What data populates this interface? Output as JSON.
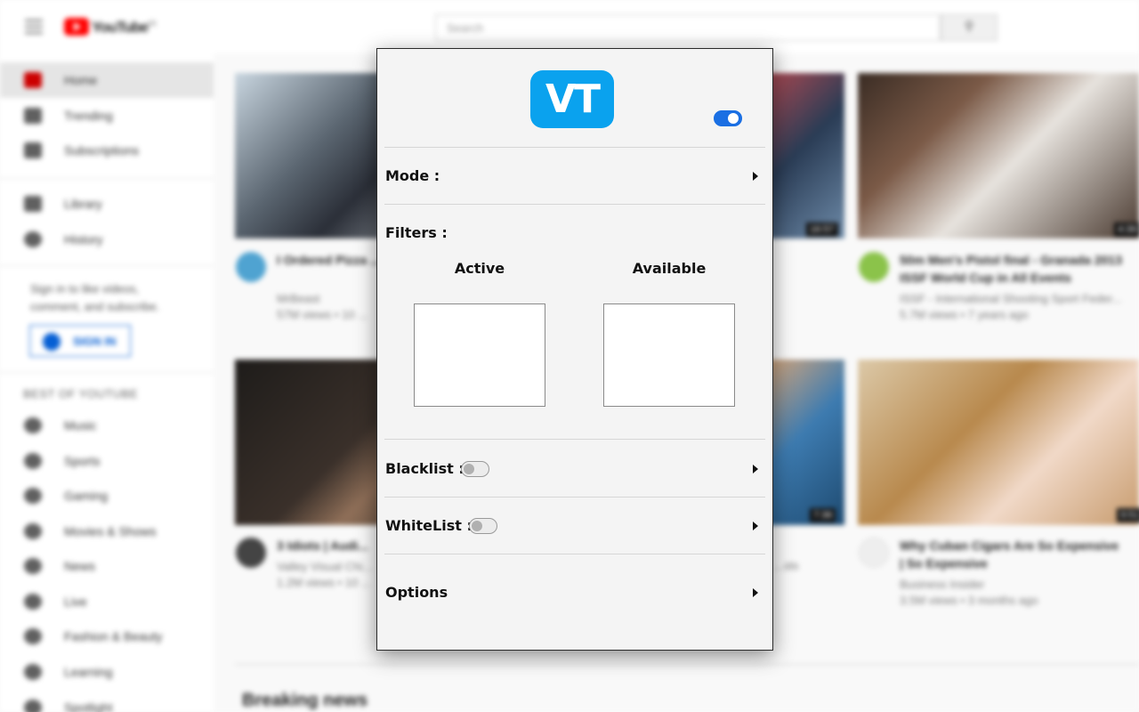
{
  "youtube": {
    "wordmark": "YouTube",
    "region": "FR",
    "search_placeholder": "Search",
    "sidebar": {
      "main": [
        "Home",
        "Trending",
        "Subscriptions"
      ],
      "library": [
        "Library",
        "History"
      ],
      "signin_text": "Sign in to like videos, comment, and subscribe.",
      "signin_button": "SIGN IN",
      "best_heading": "BEST OF YOUTUBE",
      "best": [
        "Music",
        "Sports",
        "Gaming",
        "Movies & Shows",
        "News",
        "Live",
        "Fashion & Beauty",
        "Learning",
        "Spotlight"
      ]
    },
    "videos": [
      {
        "title": "I Ordered Pizza ... House",
        "channel": "MrBeast",
        "meta": "57M views • 10 ...",
        "duration": ""
      },
      {
        "title": "",
        "channel": "",
        "meta": "",
        "duration": "16:57"
      },
      {
        "title": "50m Men's Pistol final - Granada 2013 ISSF World Cup in All Events",
        "channel": "ISSF - International Shooting Sport Feder...",
        "meta": "5.7M views • 7 years ago",
        "duration": "4:39"
      },
      {
        "title": "3 Idiots | Audi...",
        "channel": "Valley Visual Chi...",
        "meta": "1.2M views • 10 ...",
        "duration": ""
      },
      {
        "title": "",
        "channel": "",
        "meta": "...sts",
        "duration": "7:36"
      },
      {
        "title": "Why Cuban Cigars Are So Expensive | So Expensive",
        "channel": "Business Insider",
        "meta": "3.5M views • 3 months ago",
        "duration": "9:51"
      }
    ],
    "section_title": "Breaking news"
  },
  "popup": {
    "logo_text": "VT",
    "enabled": true,
    "mode_label": "Mode :",
    "filters_label": "Filters :",
    "active_label": "Active",
    "available_label": "Available",
    "blacklist_label": "Blacklist :",
    "blacklist_enabled": false,
    "whitelist_label": "WhiteList :",
    "whitelist_enabled": false,
    "options_label": "Options"
  }
}
